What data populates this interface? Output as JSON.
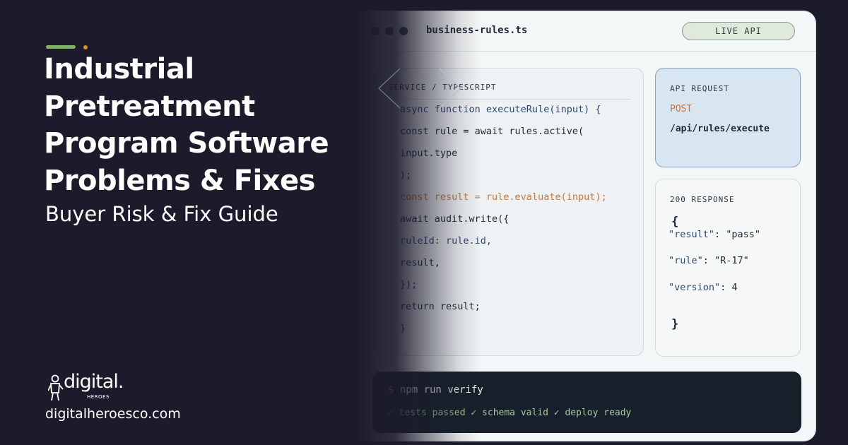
{
  "hero": {
    "headline_lines": [
      "Industrial",
      "Pretreatment",
      "Program Software",
      "Problems & Fixes"
    ],
    "subtitle": "Buyer Risk & Fix Guide"
  },
  "brand": {
    "logo_word": "digital.",
    "logo_sub": "HEROES",
    "website": "digitalheroesco.com",
    "accent_green": "#7fb26b",
    "accent_orange": "#e08a37",
    "background": "#1b1b2b"
  },
  "window": {
    "filename": "business-rules.ts",
    "status_pill": "LIVE API",
    "code_panel": {
      "label": "SERVICE / TYPESCRIPT",
      "lines": [
        "async function executeRule(input) {",
        "const rule = await rules.active(",
        "input.type",
        ");",
        "const result = rule.evaluate(input);",
        "await audit.write({",
        "ruleId: rule.id,",
        "result,",
        "});",
        "return result;",
        "}"
      ]
    },
    "request_panel": {
      "label": "API REQUEST",
      "method": "POST",
      "endpoint": "/api/rules/execute"
    },
    "response_panel": {
      "label": "200 RESPONSE",
      "open_brace": "{",
      "close_brace": "}",
      "fields": [
        {
          "key": "\"result\"",
          "value": ": \"pass\""
        },
        {
          "key": "\"rule\"",
          "value": ": \"R-17\""
        },
        {
          "key": "\"version\"",
          "value": ": 4"
        }
      ]
    },
    "terminal": {
      "command": "$ npm run verify",
      "output": "✓ tests passed ✓ schema valid ✓ deploy ready"
    }
  }
}
